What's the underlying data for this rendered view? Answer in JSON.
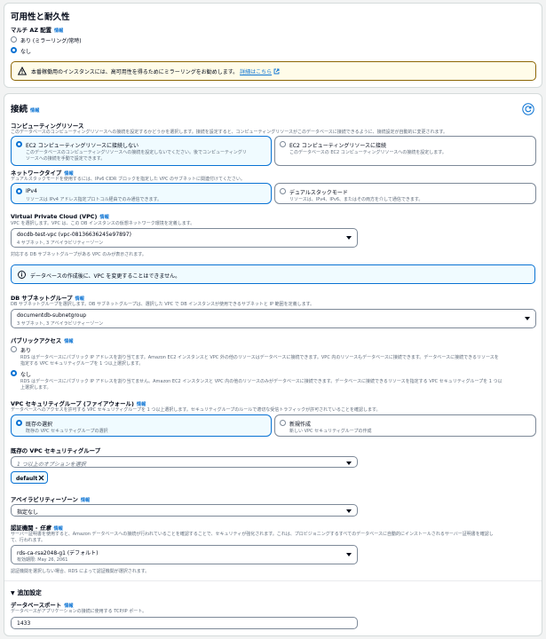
{
  "availability": {
    "title": "可用性と耐久性",
    "multi_az_label": "マルチ AZ 配置",
    "multi_az_info": "情報",
    "options": [
      "あり (ミラーリング/常時)",
      "なし"
    ],
    "warning": "本番稼働用のインスタンスには、高可用性を得るためにミラーリングをお勧めします。",
    "warning_link": "詳細はこちら"
  },
  "connectivity": {
    "title": "接続",
    "info": "情報",
    "compute": {
      "label": "コンピューティングリソース",
      "desc": "このデータベースのコンピューティングリソースへの接続を設定するかどうかを選択します。接続を設定すると、コンピューティングリソースがこのデータベースに接続できるように、接続設定が自動的に変更されます。",
      "opt1_title": "EC2 コンピューティングリソースに接続しない",
      "opt1_desc1": "このデータベースのコンピューティングリソースへの接続を設定しないでください。後でコンピューティングリ",
      "opt1_desc2": "ソースへの接続を手動で設定できます。",
      "opt2_title": "EC2 コンピューティングリソースに接続",
      "opt2_desc": "このデータベースの EC2 コンピューティングリソースへの接続を設定します。"
    },
    "network": {
      "label": "ネットワークタイプ",
      "info": "情報",
      "desc": "デュアルスタックモードを使用するには、IPv6 CIDR ブロックを指定した VPC のサブネットに関連付けてください。",
      "opt1_title": "IPv4",
      "opt1_desc": "リソースは IPv4 アドレス指定プロトコル経由でのみ通信できます。",
      "opt2_title": "デュアルスタックモード",
      "opt2_desc": "リソースは、IPv4、IPv6、またはその両方を介して通信できます。"
    },
    "vpc": {
      "label": "Virtual Private Cloud (VPC)",
      "info": "情報",
      "desc": "VPC を選択します。VPC は、この DB インスタンスの仮想ネットワーク環境を定義します。",
      "value": "docdb-test-vpc (vpc-08136636245e97897)",
      "sub": "4 サブネット, 3 アベイラビリティーゾーン",
      "note": "対応する DB サブネットグループがある VPC のみが表示されます。",
      "alert": "データベースの作成後に、VPC を変更することはできません。"
    },
    "subnet": {
      "label": "DB サブネットグループ",
      "info": "情報",
      "desc": "DB サブネットグループを選択します。DB サブネットグループは、選択した VPC で DB インスタンスが使用できるサブネットと IP 範囲を定義します。",
      "value": "documentdb-subnetgroup",
      "sub": "3 サブネット, 3 アベイラビリティーゾーン"
    },
    "public": {
      "label": "パブリックアクセス",
      "info": "情報",
      "opt1": "あり",
      "opt1_desc1": "RDS はデータベースにパブリック IP アドレスを割り当てます。Amazon EC2 インスタンスと VPC 外の他のリソースはデータベースに接続できます。VPC 内のリソースもデータベースに接続できます。データベースに接続できるリソースを",
      "opt1_desc2": "指定する VPC セキュリティグループを 1 つ以上選択します。",
      "opt2": "なし",
      "opt2_desc1": "RDS はデータベースにパブリック IP アドレスを割り当てません。Amazon EC2 インスタンスと VPC 内の他のリソースのみがデータベースに接続できます。データベースに接続できるリソースを指定する VPC セキュリティグループを 1 つ以",
      "opt2_desc2": "上選択します。"
    },
    "sg": {
      "label": "VPC セキュリティグループ (ファイアウォール)",
      "info": "情報",
      "desc": "データベースへのアクセスを許可する VPC セキュリティグループを 1 つ以上選択します。セキュリティグループのルールで適切な受信トラフィックが許可されていることを確認します。",
      "opt1_title": "既存の選択",
      "opt1_desc": "既存の VPC セキュリティグループの選択",
      "opt2_title": "新規作成",
      "opt2_desc": "新しい VPC セキュリティグループの作成",
      "existing_label": "既存の VPC セキュリティグループ",
      "existing_placeholder": "1 つ以上のオプションを選択",
      "token": "default"
    },
    "az": {
      "label": "アベイラビリティーゾーン",
      "info": "情報",
      "value": "指定なし"
    },
    "cert": {
      "label": "認証機関 - ",
      "optional": "任意",
      "info": "情報",
      "desc1": "サーバー証明書を使用すると、Amazon データベースへの接続が行われていることを確認することで、セキュリティが強化されます。これは、プロビジョニングするすべてのデータベースに自動的にインストールされるサーバー証明書を確認し",
      "desc2": "て、行われます。",
      "value": "rds-ca-rsa2048-g1 (デフォルト)",
      "sub": "有効期限: May 26, 2061",
      "note": "認証機関を選択しない場合、RDS によって認証機関が選択されます。"
    },
    "additional": {
      "title": "追加設定",
      "port_label": "データベースポート",
      "port_info": "情報",
      "port_desc": "データベースがアプリケーションの接続に使用する TCP/IP ポート。",
      "port_value": "1433"
    }
  },
  "colors": {
    "accent": "#0972d3",
    "warning_border": "#8d6605",
    "warning_bg": "#fffce9"
  }
}
